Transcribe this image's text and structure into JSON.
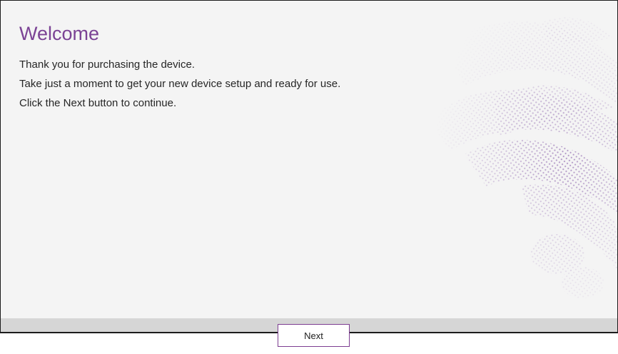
{
  "welcome": {
    "title": "Welcome",
    "lines": [
      "Thank you for purchasing the device.",
      "Take just a moment to get your new device setup and ready for use.",
      "Click the Next button to continue."
    ]
  },
  "footer": {
    "next_label": "Next"
  },
  "colors": {
    "title": "#7b4395",
    "text": "#262626",
    "background": "#f4f4f4",
    "footer": "#d6d6d6",
    "button_border": "#7d3d91",
    "decoration_dots": "#a98bc0"
  },
  "decoration": {
    "icon": "dotted-swirl-graphic"
  }
}
